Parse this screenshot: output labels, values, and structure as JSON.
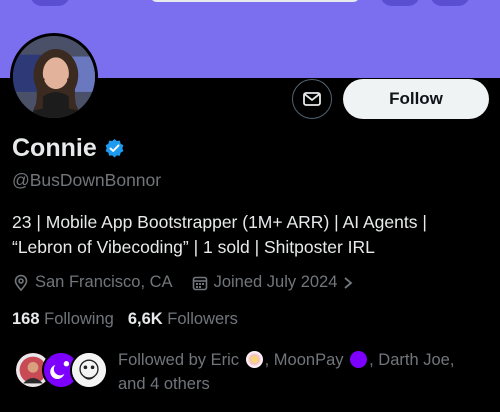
{
  "profile": {
    "name": "Connie",
    "handle": "@BusDownBonnor",
    "bio_line1": "23 | Mobile App Bootstrapper (1M+ ARR) | AI Agents |",
    "bio_line2": "“Lebron of Vibecoding” | 1 sold | Shitposter IRL",
    "location": "San Francisco, CA",
    "joined": "Joined July 2024",
    "verified": true
  },
  "actions": {
    "follow_label": "Follow"
  },
  "stats": {
    "following_count": "168",
    "following_label": "Following",
    "followers_count": "6,6K",
    "followers_label": "Followers"
  },
  "followed_by": {
    "prefix": "Followed by Eric",
    "part2": ", MoonPay",
    "part3": ", Darth Joe,",
    "line2": "and 4 others"
  },
  "colors": {
    "banner": "#7b6ff0",
    "verified": "#1d9bf0",
    "moonpay": "#7d00ff",
    "follow_bg": "#eff3f4",
    "muted": "#71767b"
  },
  "icons": [
    "envelope-icon",
    "verified-badge-icon",
    "location-pin-icon",
    "calendar-icon",
    "chevron-right-icon"
  ]
}
